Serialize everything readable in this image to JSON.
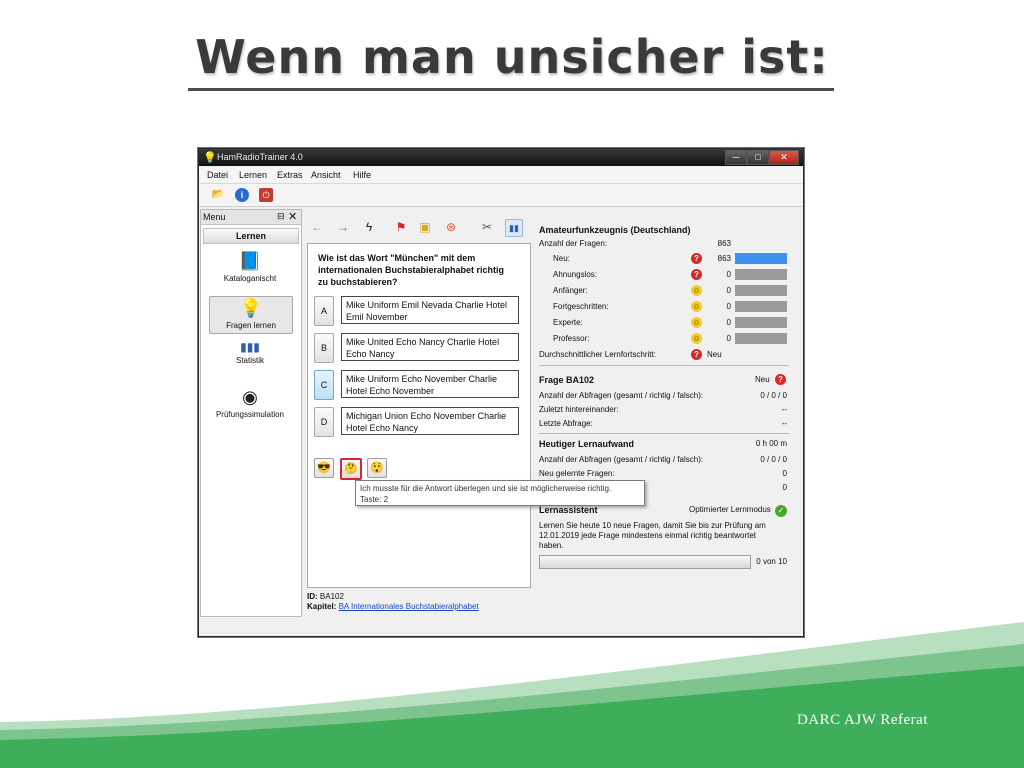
{
  "slide": {
    "title": "Wenn man unsicher ist:",
    "footer": "DARC AJW Referat"
  },
  "window": {
    "title": "HamRadioTrainer 4.0",
    "controls": {
      "minimize": "─",
      "maximize": "□",
      "close": "✕"
    }
  },
  "menubar": [
    "Datei",
    "Lernen",
    "Extras",
    "Ansicht",
    "Hilfe"
  ],
  "sidebar": {
    "header": "Menu",
    "pin": "⊟",
    "close": "✕",
    "section": "Lernen",
    "items": [
      {
        "label": "Kataloganischt",
        "icon": "catalog-icon"
      },
      {
        "label": "Fragen lernen",
        "icon": "lightbulb-icon"
      },
      {
        "label": "Statistik",
        "icon": "bar-chart-icon"
      },
      {
        "label": "Prüfungssimulation",
        "icon": "clock-icon"
      }
    ]
  },
  "question": {
    "text": "Wie ist das Wort \"München\" mit dem internationalen Buchstabieralphabet richtig zu buchstabieren?",
    "answers": [
      {
        "letter": "A",
        "text": "Mike Uniform Emil Nevada Charlie Hotel Emil November"
      },
      {
        "letter": "B",
        "text": "Mike United Echo Nancy Charlie Hotel Echo Nancy"
      },
      {
        "letter": "C",
        "text": "Mike Uniform Echo November Charlie Hotel Echo November"
      },
      {
        "letter": "D",
        "text": "Michigan Union Echo November Charlie Hotel Echo Nancy"
      }
    ],
    "tooltip_line1": "Ich musste für die Antwort überlegen und sie ist möglicherweise richtig.",
    "tooltip_line2": "Taste: 2",
    "id_label": "ID:",
    "id_value": "BA102",
    "kapitel_label": "Kapitel:",
    "kapitel_value": "BA Internationales Buchstabieralphabet"
  },
  "stats": {
    "title": "Amateurfunkzeugnis (Deutschland)",
    "count_label": "Anzahl der Fragen:",
    "count_value": "863",
    "levels": [
      {
        "label": "Neu:",
        "value": "863",
        "share": 1.0
      },
      {
        "label": "Ahnungslos:",
        "value": "0",
        "share": 0
      },
      {
        "label": "Anfänger:",
        "value": "0",
        "share": 0
      },
      {
        "label": "Fortgeschritten:",
        "value": "0",
        "share": 0
      },
      {
        "label": "Experte:",
        "value": "0",
        "share": 0
      },
      {
        "label": "Professor:",
        "value": "0",
        "share": 0
      }
    ],
    "avg_label": "Durchschnittlicher Lernfortschritt:",
    "avg_value": "Neu",
    "frage_title": "Frage BA102",
    "frage_status": "Neu",
    "frage_rows": [
      {
        "label": "Anzahl der Abfragen (gesamt / richtig / falsch):",
        "value": "0 / 0 / 0"
      },
      {
        "label": "Zuletzt hintereinander:",
        "value": "--"
      },
      {
        "label": "Letzte Abfrage:",
        "value": "--"
      }
    ],
    "heute_title": "Heutiger Lernaufwand",
    "heute_time": "0 h 00 m",
    "heute_rows": [
      {
        "label": "Anzahl der Abfragen (gesamt / richtig / falsch):",
        "value": "0 / 0 / 0"
      },
      {
        "label": "Neu gelernte Fragen:",
        "value": "0"
      },
      {
        "label": "",
        "value": "0"
      }
    ],
    "assist_title": "Lernassistent",
    "assist_mode": "Optimierter Lernmodus",
    "assist_text": "Lernen Sie heute 10 neue Fragen, damit Sie bis zur Prüfung am 12.01.2019 jede Frage mindestens einmal richtig beantwortet haben.",
    "progress_text": "0 von 10",
    "progress_fraction": 0
  },
  "colors": {
    "accent_blue": "#3d8ff1",
    "highlight_red": "#d6262f",
    "wave_green": "#3fae5a"
  }
}
